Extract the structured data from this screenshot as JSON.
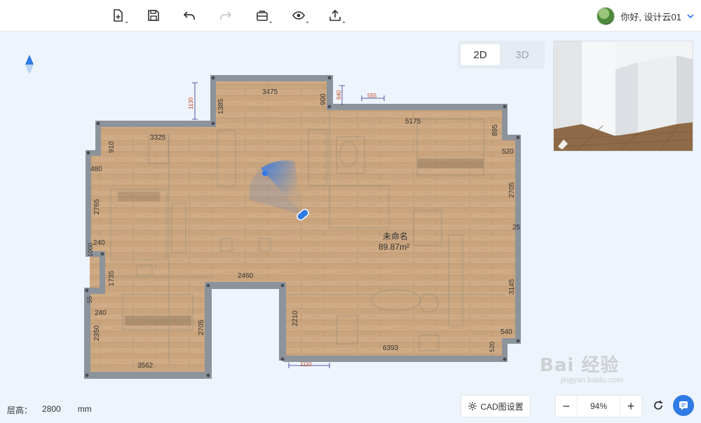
{
  "toolbar": {
    "new_label": "新建",
    "save_label": "保存",
    "undo_label": "撤销",
    "redo_label": "重做",
    "toolbox_label": "工具",
    "view_label": "预览",
    "export_label": "导出"
  },
  "user": {
    "greeting": "你好, 设计云01"
  },
  "view_modes": {
    "mode_2d": "2D",
    "mode_3d": "3D",
    "active": "2D"
  },
  "room": {
    "name": "未命名",
    "area": "89.87m²"
  },
  "dimensions": {
    "top_center": "3475",
    "top_small": "555",
    "top_left": "3325",
    "top_right": "5175",
    "left_outer_1": "1130",
    "left_inner_1": "1385",
    "mid_900": "900",
    "mid_640": "640",
    "right_895": "895",
    "right_520": "520",
    "right_2705": "2705",
    "right_25": "25",
    "left_910": "910",
    "left_480": "480",
    "left_2765": "2765",
    "left_1000": "1000",
    "left_240a": "240",
    "left_1735": "1735",
    "left_55": "55",
    "left_240b": "240",
    "left_2350": "2350",
    "inner_2705": "2705",
    "bottom_3562": "3562",
    "inner_2460": "2460",
    "inner_2210": "2210",
    "right_3145": "3145",
    "right_540": "540",
    "bottom_6393": "6393",
    "right_520b": "520",
    "bottom_1110": "1110"
  },
  "footer": {
    "floor_height_label": "层高：",
    "floor_height_value": "2800",
    "floor_height_unit": "mm",
    "cad_settings_label": "CAD图设置",
    "zoom_level": "94%",
    "zoom_out": "−",
    "zoom_in": "+"
  },
  "watermark": {
    "text": "Bai 经验",
    "sub": "jingyan.baidu.com"
  },
  "colors": {
    "wall": "#8d939b",
    "floor": "#caa47e",
    "accent": "#2f7ae5",
    "dimension": "#2a2f8f"
  },
  "icons": [
    "new-file-icon",
    "save-icon",
    "undo-icon",
    "redo-icon",
    "toolbox-icon",
    "eye-icon",
    "export-icon",
    "chevron-down-icon",
    "north-arrow-icon",
    "gear-icon",
    "refresh-icon",
    "chat-icon",
    "camera-icon"
  ]
}
